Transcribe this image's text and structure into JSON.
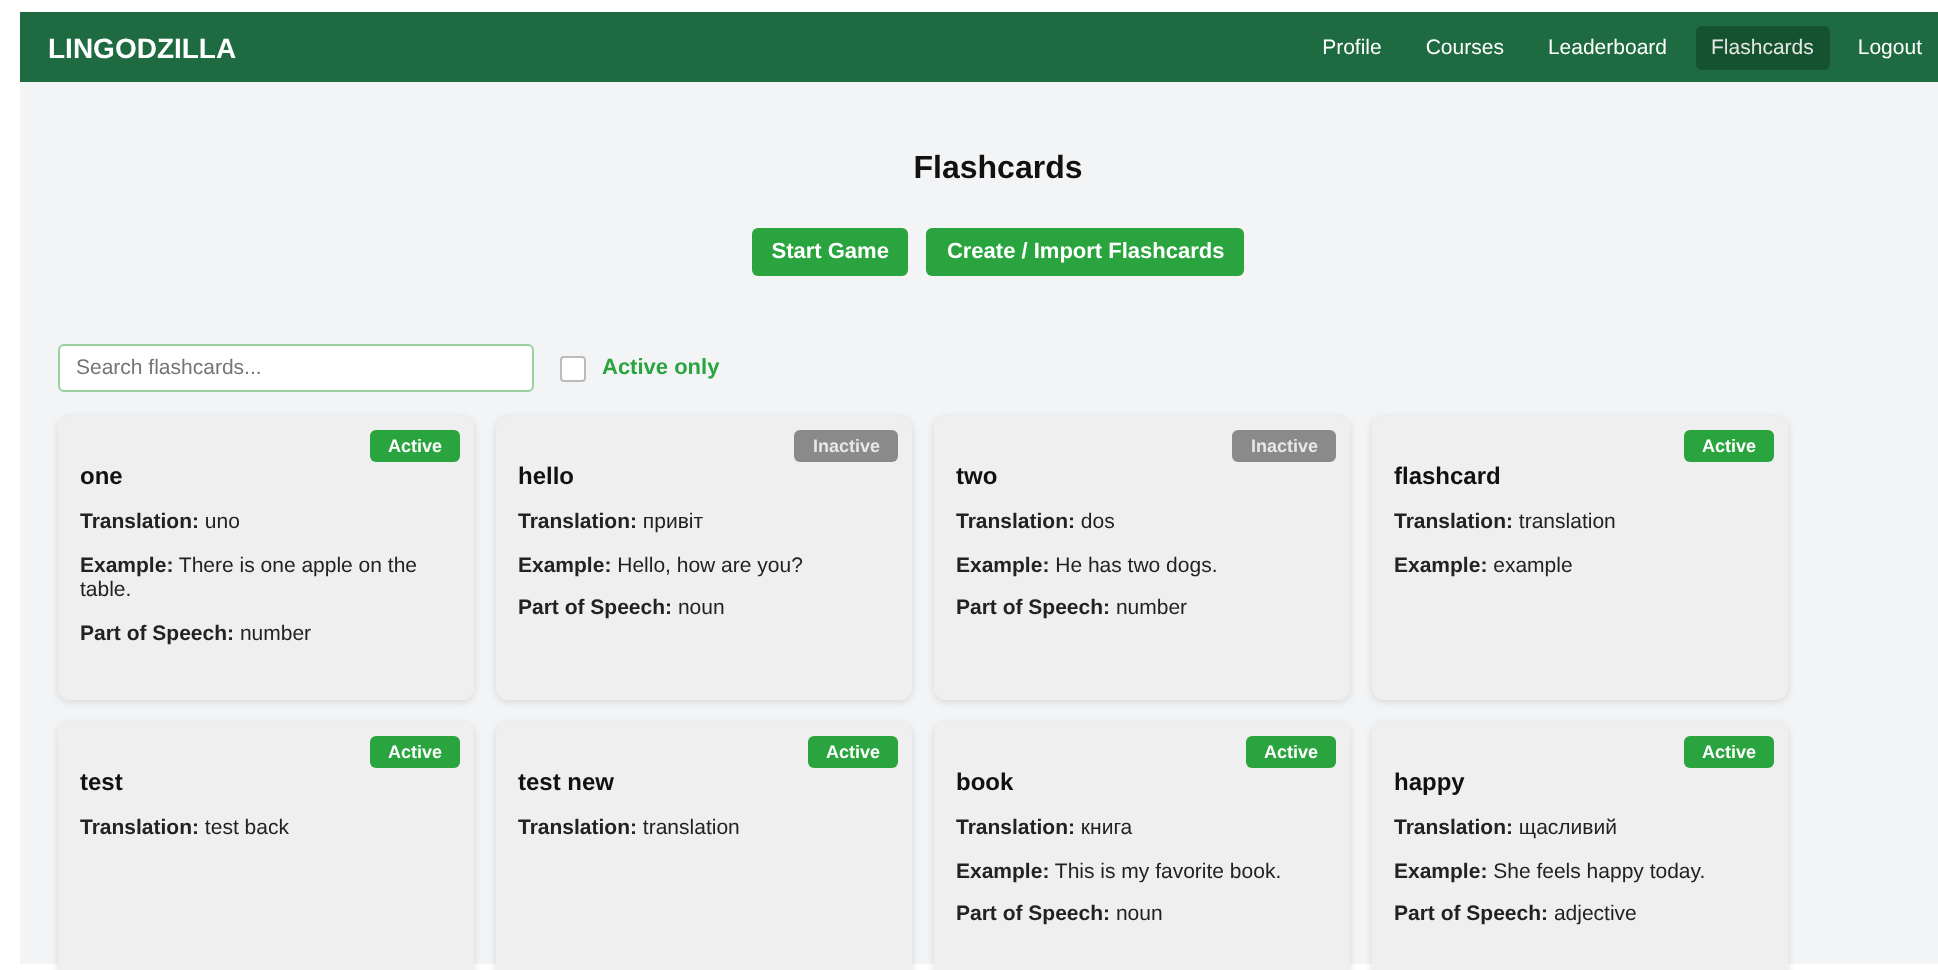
{
  "navbar": {
    "brand": "LINGODZILLA",
    "links": [
      {
        "label": "Profile",
        "selected": false
      },
      {
        "label": "Courses",
        "selected": false
      },
      {
        "label": "Leaderboard",
        "selected": false
      },
      {
        "label": "Flashcards",
        "selected": true
      },
      {
        "label": "Logout",
        "selected": false
      }
    ]
  },
  "page_title": "Flashcards",
  "buttons": [
    "Start Game",
    "Create / Import Flashcards"
  ],
  "search": {
    "placeholder": "Search flashcards..."
  },
  "filter": {
    "label": "Active only",
    "checked": false
  },
  "cards": [
    {
      "word": "one",
      "status": "Active",
      "active": true,
      "fields": [
        "**Translation:** uno",
        "**Example:** There is one apple on the table.",
        "**Part of Speech:** number"
      ]
    },
    {
      "word": "hello",
      "status": "Inactive",
      "active": false,
      "fields": [
        "**Translation:** привіт",
        "**Example:** Hello, how are you?",
        "**Part of Speech:** noun"
      ]
    },
    {
      "word": "two",
      "status": "Inactive",
      "active": false,
      "fields": [
        "**Translation:** dos",
        "**Example:** He has two dogs.",
        "**Part of Speech:** number"
      ]
    },
    {
      "word": "flashcard",
      "status": "Active",
      "active": true,
      "fields": [
        "**Translation:** translation",
        "**Example:** example"
      ]
    },
    {
      "word": "test",
      "status": "Active",
      "active": true,
      "fields": [
        "**Translation:** test back"
      ]
    },
    {
      "word": "test new",
      "status": "Active",
      "active": true,
      "fields": [
        "**Translation:** translation"
      ]
    },
    {
      "word": "book",
      "status": "Active",
      "active": true,
      "fields": [
        "**Translation:** книга",
        "**Example:** This is my favorite book.",
        "**Part of Speech:** noun"
      ]
    },
    {
      "word": "happy",
      "status": "Active",
      "active": true,
      "fields": [
        "**Translation:** щасливий",
        "**Example:** She feels happy today.",
        "**Part of Speech:** adjective"
      ]
    }
  ]
}
